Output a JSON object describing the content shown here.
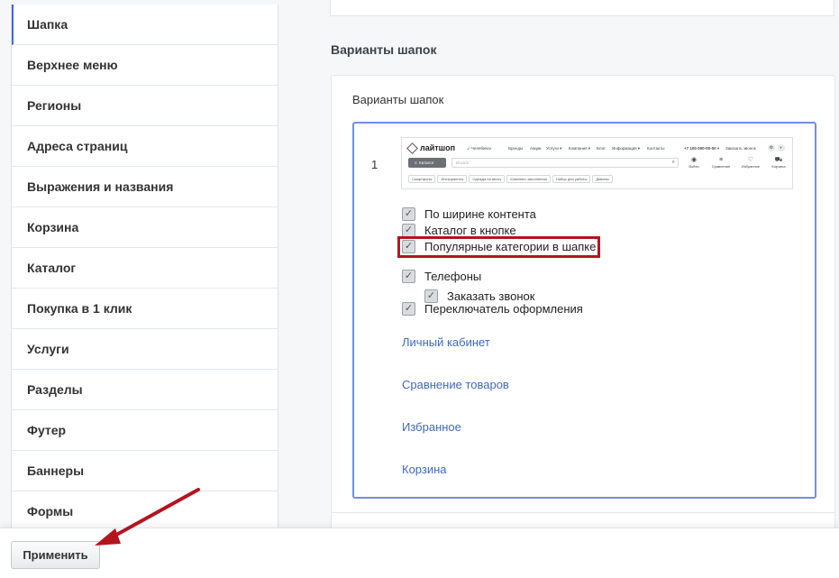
{
  "sidebar": {
    "items": [
      {
        "label": "Шапка"
      },
      {
        "label": "Верхнее меню"
      },
      {
        "label": "Регионы"
      },
      {
        "label": "Адреса страниц"
      },
      {
        "label": "Выражения и названия"
      },
      {
        "label": "Корзина"
      },
      {
        "label": "Каталог"
      },
      {
        "label": "Покупка в 1 клик"
      },
      {
        "label": "Услуги"
      },
      {
        "label": "Разделы"
      },
      {
        "label": "Футер"
      },
      {
        "label": "Баннеры"
      },
      {
        "label": "Формы"
      }
    ],
    "active_index": 0
  },
  "main": {
    "section_title": "Варианты шапок",
    "card_title": "Варианты шапок",
    "variant": {
      "number": "1",
      "preview": {
        "logo": "лайтшоп",
        "city": "Челябинск",
        "menu": [
          "Бренды",
          "Акции",
          "Услуги ▾",
          "Компания ▾",
          "Блог",
          "Информация ▾",
          "Контакты"
        ],
        "phone": "+7 100 000-00-00 ▾",
        "callback": "Заказать звонок",
        "catalog_button": "Каталог",
        "search_placeholder": "Искать",
        "icons": [
          "Войти",
          "Сравнение",
          "Избранное",
          "Корзина"
        ],
        "chips": [
          "Смартфоны",
          "Инструменты",
          "Одежда на весну",
          "Комплект заполнения",
          "Набор для работы",
          "Диваны"
        ]
      },
      "options": [
        {
          "label": "По ширине контента",
          "checked": true
        },
        {
          "label": "Каталог в кнопке",
          "checked": true
        },
        {
          "label": "Популярные категории в шапке",
          "checked": true
        },
        {
          "label": "Телефоны",
          "checked": true
        },
        {
          "label": "Заказать звонок",
          "checked": true
        },
        {
          "label": "Переключатель оформления",
          "checked": true
        }
      ],
      "links": [
        "Личный кабинет",
        "Сравнение товаров",
        "Избранное",
        "Корзина"
      ]
    }
  },
  "footer": {
    "apply_label": "Применить"
  },
  "colors": {
    "accent": "#3f68e6",
    "highlight": "#b4141f",
    "link": "#3f68c6"
  }
}
